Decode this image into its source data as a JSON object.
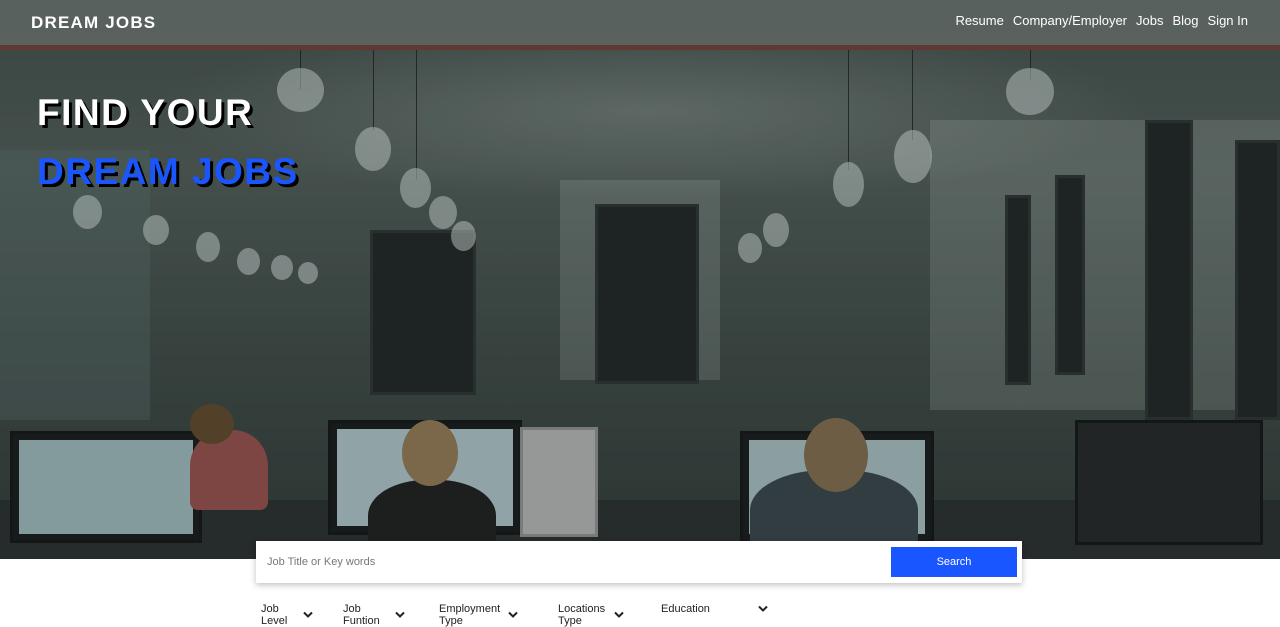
{
  "brand": "DREAM JOBS",
  "nav": [
    "Resume",
    "Company/Employer",
    "Jobs",
    "Blog",
    "Sign In"
  ],
  "hero": {
    "line1": "FIND YOUR",
    "line2": "DREAM JOBS"
  },
  "search": {
    "placeholder": "Job Title or Key words",
    "button": "Search"
  },
  "filters": [
    "Job Level",
    "Job Funtion",
    "Employment Type",
    "Locations Type",
    "Education"
  ],
  "colors": {
    "accent": "#1a56ff",
    "navbar": "#5c6461"
  }
}
